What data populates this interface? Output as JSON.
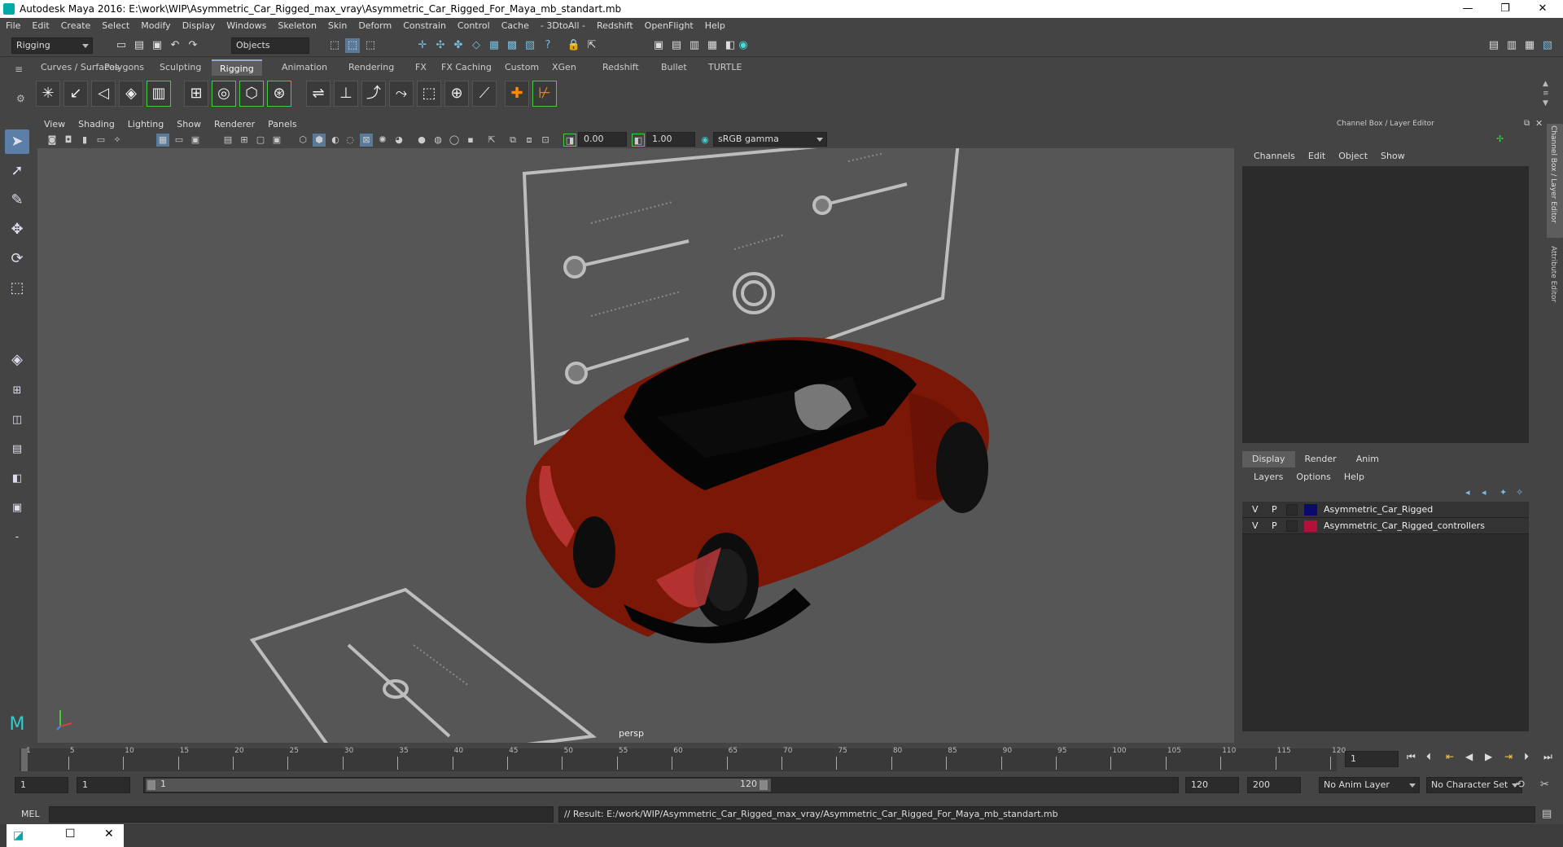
{
  "window": {
    "title": "Autodesk Maya 2016: E:\\work\\WIP\\Asymmetric_Car_Rigged_max_vray\\Asymmetric_Car_Rigged_For_Maya_mb_standart.mb",
    "minimize": "—",
    "restore": "❐",
    "close": "✕"
  },
  "menu": [
    "File",
    "Edit",
    "Create",
    "Select",
    "Modify",
    "Display",
    "Windows",
    "Skeleton",
    "Skin",
    "Deform",
    "Constrain",
    "Control",
    "Cache",
    "- 3DtoAll -",
    "Redshift",
    "OpenFlight",
    "Help"
  ],
  "status": {
    "mode": "Rigging",
    "selection_mode": "Objects"
  },
  "shelf_tabs": [
    "Curves / Surfaces",
    "Polygons",
    "Sculpting",
    "Rigging",
    "Animation",
    "Rendering",
    "FX",
    "FX Caching",
    "Custom",
    "XGen",
    "Redshift",
    "Bullet",
    "TURTLE"
  ],
  "shelf_active": "Rigging",
  "viewport": {
    "menus": [
      "View",
      "Shading",
      "Lighting",
      "Show",
      "Renderer",
      "Panels"
    ],
    "exposure": "0.00",
    "gamma": "1.00",
    "color_space": "sRGB gamma",
    "camera_label": "persp"
  },
  "channel_box": {
    "title": "Channel Box / Layer Editor",
    "menus": [
      "Channels",
      "Edit",
      "Object",
      "Show"
    ],
    "side_tabs": [
      "Channel Box / Layer Editor",
      "Attribute Editor"
    ],
    "layer_tabs": [
      "Display",
      "Render",
      "Anim"
    ],
    "layer_menus": [
      "Layers",
      "Options",
      "Help"
    ],
    "layers": [
      {
        "v": "V",
        "p": "P",
        "color": "#0a0a6e",
        "name": "Asymmetric_Car_Rigged"
      },
      {
        "v": "V",
        "p": "P",
        "color": "#b0103a",
        "name": "Asymmetric_Car_Rigged_controllers"
      }
    ]
  },
  "timeline": {
    "ticks": [
      "1",
      "5",
      "10",
      "15",
      "20",
      "25",
      "30",
      "35",
      "40",
      "45",
      "50",
      "55",
      "60",
      "65",
      "70",
      "75",
      "80",
      "85",
      "90",
      "95",
      "100",
      "105",
      "110",
      "115",
      "120"
    ],
    "current_frame": "1"
  },
  "range": {
    "start": "1",
    "playback_start": "1",
    "slider_start": "1",
    "slider_end": "120",
    "playback_end": "120",
    "end": "200",
    "anim_layer": "No Anim Layer",
    "character_set": "No Character Set"
  },
  "command": {
    "lang": "MEL",
    "result": "// Result: E:/work/WIP/Asymmetric_Car_Rigged_max_vray/Asymmetric_Car_Rigged_For_Maya_mb_standart.mb"
  },
  "colors": {
    "car_body": "#8a1a0a",
    "accent": "#5ab"
  }
}
